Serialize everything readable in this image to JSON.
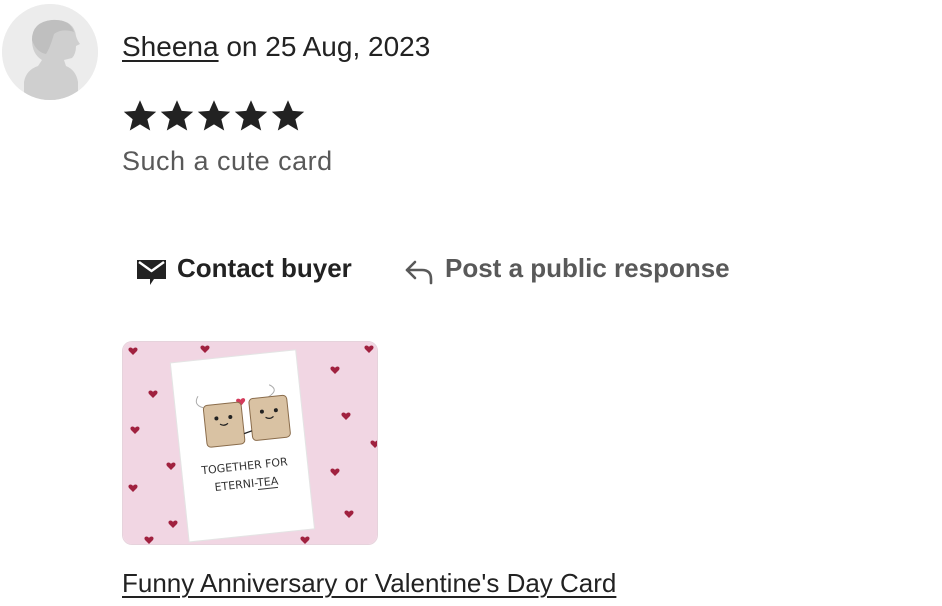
{
  "review": {
    "reviewer_name": "Sheena",
    "date_text": " on 25 Aug, 2023",
    "rating": 5,
    "rating_max": 5,
    "text": "Such a cute card",
    "avatar_icon": "default-user-silhouette-icon"
  },
  "actions": {
    "contact_label": "Contact buyer",
    "contact_icon": "envelope-icon",
    "response_label": "Post a public response",
    "response_icon": "reply-arrow-icon"
  },
  "listing": {
    "title": "Funny Anniversary or Valentine's Day Card",
    "card_text_line1": "TOGETHER FOR",
    "card_text_line2": "ETERNI-TEA"
  },
  "colors": {
    "text_primary": "#222222",
    "text_secondary": "#595959",
    "star": "#222222",
    "thumb_background": "#f1d6e3",
    "heart": "#a0213f"
  }
}
